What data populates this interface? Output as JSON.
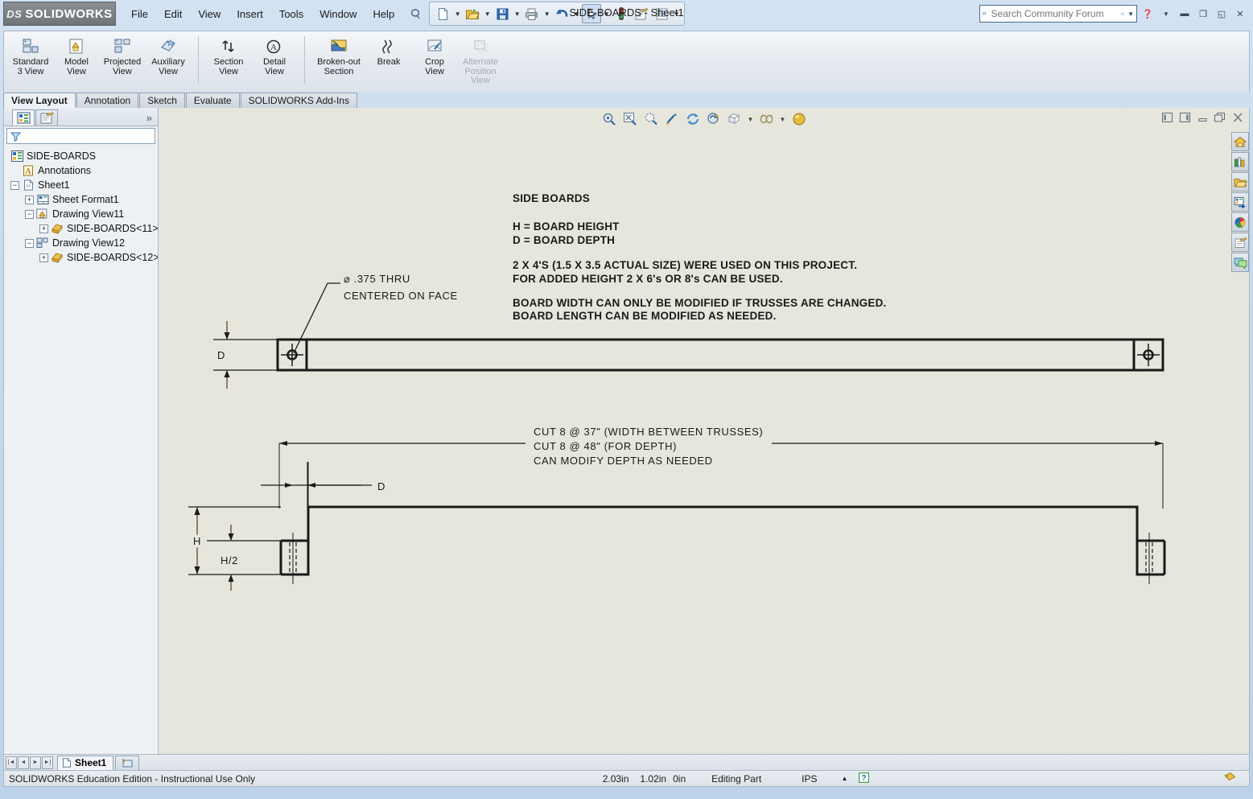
{
  "window": {
    "brand": "SOLIDWORKS",
    "brand_prefix": "DS",
    "document_title": "SIDE-BOARDS - Sheet1"
  },
  "menu": {
    "items": [
      {
        "label": "File"
      },
      {
        "label": "Edit"
      },
      {
        "label": "View"
      },
      {
        "label": "Insert"
      },
      {
        "label": "Tools"
      },
      {
        "label": "Window"
      },
      {
        "label": "Help"
      }
    ],
    "pin_icon": "pushpin-icon"
  },
  "quick_access": {
    "buttons": [
      {
        "name": "new-document-icon",
        "has_dropdown": true
      },
      {
        "name": "open-document-icon",
        "has_dropdown": true
      },
      {
        "name": "save-icon",
        "has_dropdown": true
      },
      {
        "name": "print-icon",
        "has_dropdown": true
      },
      {
        "name": "undo-icon",
        "has_dropdown": true
      },
      {
        "name": "select-arrow-icon",
        "has_dropdown": true,
        "selected": true
      },
      {
        "name": "rebuild-traffic-light-icon",
        "has_dropdown": false
      },
      {
        "name": "drawing-sheet-properties-icon",
        "has_dropdown": false
      },
      {
        "name": "options-icon",
        "has_dropdown": true
      }
    ]
  },
  "search": {
    "placeholder": "Search Community Forum",
    "value": "",
    "icon": "forum-search-icon",
    "magnifier": "magnifier-icon"
  },
  "window_buttons": {
    "help": "help-question-icon",
    "minimize": "minimize-icon",
    "restore": "restore-icon",
    "maximize": "maximize-icon",
    "close": "close-icon"
  },
  "ribbon": {
    "groups": [
      {
        "buttons": [
          {
            "label": "Standard\n3 View",
            "lines": [
              "Standard",
              "3 View"
            ],
            "icon": "standard-3-view-icon",
            "enabled": true
          },
          {
            "label": "Model View",
            "lines": [
              "Model",
              "View"
            ],
            "icon": "model-view-icon",
            "enabled": true
          },
          {
            "label": "Projected View",
            "lines": [
              "Projected",
              "View"
            ],
            "icon": "projected-view-icon",
            "enabled": true
          },
          {
            "label": "Auxiliary View",
            "lines": [
              "Auxiliary",
              "View"
            ],
            "icon": "auxiliary-view-icon",
            "enabled": true
          }
        ]
      },
      {
        "buttons": [
          {
            "label": "Section View",
            "lines": [
              "Section",
              "View"
            ],
            "icon": "section-view-icon",
            "enabled": true
          },
          {
            "label": "Detail View",
            "lines": [
              "Detail",
              "View"
            ],
            "icon": "detail-view-icon",
            "enabled": true
          }
        ]
      },
      {
        "buttons": [
          {
            "label": "Broken-out Section",
            "lines": [
              "Broken-out",
              "Section"
            ],
            "icon": "broken-out-section-icon",
            "enabled": true
          },
          {
            "label": "Break",
            "lines": [
              "Break"
            ],
            "icon": "break-icon",
            "enabled": true
          },
          {
            "label": "Crop View",
            "lines": [
              "Crop",
              "View"
            ],
            "icon": "crop-view-icon",
            "enabled": true
          },
          {
            "label": "Alternate Position View",
            "lines": [
              "Alternate",
              "Position",
              "View"
            ],
            "icon": "alternate-position-view-icon",
            "enabled": false
          }
        ]
      }
    ]
  },
  "tabs": [
    {
      "label": "View Layout",
      "active": true
    },
    {
      "label": "Annotation",
      "active": false
    },
    {
      "label": "Sketch",
      "active": false
    },
    {
      "label": "Evaluate",
      "active": false
    },
    {
      "label": "SOLIDWORKS Add-Ins",
      "active": false
    }
  ],
  "feature_manager": {
    "tabs": [
      {
        "name": "feature-manager-tab",
        "icon": "feature-tree-icon",
        "active": true
      },
      {
        "name": "property-manager-tab",
        "icon": "property-manager-icon",
        "active": false
      }
    ],
    "more_icon": "chevron-double-right-icon",
    "filter": {
      "placeholder": "",
      "value": "",
      "icon": "filter-funnel-icon"
    },
    "tree": [
      {
        "label": "SIDE-BOARDS",
        "depth": 0,
        "expander": "",
        "icon": "drawing-document-icon"
      },
      {
        "label": "Annotations",
        "depth": 1,
        "expander": "",
        "icon": "annotations-folder-icon"
      },
      {
        "label": "Sheet1",
        "depth": 1,
        "expander": "-",
        "icon": "sheet-icon"
      },
      {
        "label": "Sheet Format1",
        "depth": 2,
        "expander": "+",
        "icon": "sheet-format-icon"
      },
      {
        "label": "Drawing View11",
        "depth": 2,
        "expander": "-",
        "icon": "drawing-view-icon"
      },
      {
        "label": "SIDE-BOARDS<11>",
        "depth": 3,
        "expander": "+",
        "icon": "part-instance-icon"
      },
      {
        "label": "Drawing View12",
        "depth": 2,
        "expander": "-",
        "icon": "drawing-view-proj-icon"
      },
      {
        "label": "SIDE-BOARDS<12>",
        "depth": 3,
        "expander": "+",
        "icon": "part-instance-icon"
      }
    ]
  },
  "view_toolbar": {
    "buttons": [
      {
        "name": "zoom-to-area-icon",
        "has_dropdown": false
      },
      {
        "name": "zoom-to-fit-icon",
        "has_dropdown": false
      },
      {
        "name": "zoom-to-selection-icon",
        "has_dropdown": false
      },
      {
        "name": "previous-view-icon",
        "has_dropdown": false
      },
      {
        "name": "rebuild-icon",
        "has_dropdown": false
      },
      {
        "name": "update-view-icon",
        "has_dropdown": false
      },
      {
        "name": "display-style-icon",
        "has_dropdown": true
      },
      {
        "name": "hide-show-items-icon",
        "has_dropdown": true
      },
      {
        "name": "appearance-sphere-icon",
        "has_dropdown": false
      }
    ],
    "window_controls": [
      {
        "name": "tile-left-icon"
      },
      {
        "name": "tile-right-icon"
      },
      {
        "name": "minimize-window-icon"
      },
      {
        "name": "restore-window-icon"
      },
      {
        "name": "close-window-icon"
      }
    ]
  },
  "task_pane": [
    {
      "name": "solidworks-resources-icon"
    },
    {
      "name": "design-library-icon"
    },
    {
      "name": "file-explorer-icon"
    },
    {
      "name": "view-palette-icon"
    },
    {
      "name": "appearances-scenes-icon"
    },
    {
      "name": "custom-properties-icon"
    },
    {
      "name": "solidworks-forum-icon"
    }
  ],
  "drawing": {
    "notes": [
      "SIDE BOARDS",
      "H = BOARD HEIGHT",
      "D = BOARD DEPTH",
      "2 X 4'S (1.5 X 3.5 ACTUAL SIZE) WERE USED ON THIS PROJECT.",
      "FOR ADDED HEIGHT 2 X 6's OR 8's CAN BE USED.",
      "BOARD WIDTH CAN ONLY BE MODIFIED IF TRUSSES ARE CHANGED.",
      "BOARD LENGTH CAN BE MODIFIED AS NEEDED."
    ],
    "hole_callout_line1": "⌀ .375 THRU",
    "hole_callout_line2": "CENTERED ON FACE",
    "dim_D_top": "D",
    "cut_note_line1": "CUT 8 @ 37\" (WIDTH BETWEEN TRUSSES)",
    "cut_note_line2": "CUT 8 @ 48\" (FOR DEPTH)",
    "cut_note_line3": "CAN MODIFY DEPTH AS NEEDED",
    "dim_D_bottom": "D",
    "dim_H": "H",
    "dim_H_half": "H/2"
  },
  "sheet_bar": {
    "nav": [
      "first-sheet-icon",
      "previous-sheet-icon",
      "next-sheet-icon",
      "last-sheet-icon"
    ],
    "sheet_tab": "Sheet1",
    "sheet_tab_icon": "sheet-tab-icon",
    "add_sheet_icon": "add-sheet-icon"
  },
  "status_bar": {
    "message": "SOLIDWORKS Education Edition - Instructional Use Only",
    "coord_x": "2.03in",
    "coord_y": "1.02in",
    "coord_z": "0in",
    "mode": "Editing Part",
    "units": "IPS",
    "expand_icon": "expand-up-icon",
    "help_icon": "help-badge-icon",
    "tag_icon": "tag-icon"
  },
  "colors": {
    "drawing_background": "#e7e6dc",
    "window_chrome": "#c6d9ec",
    "panel": "#eef1f4",
    "line": "#1a1a1a"
  }
}
